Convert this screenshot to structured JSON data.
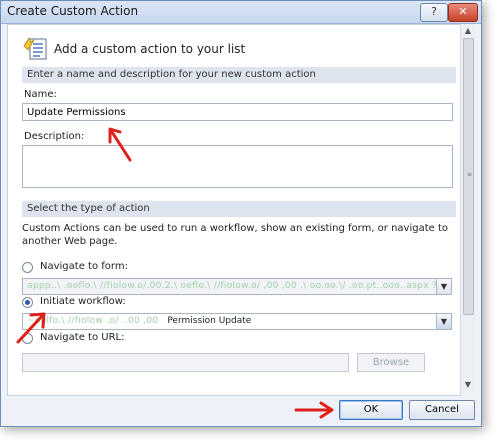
{
  "window": {
    "title": "Create Custom Action",
    "help_label": "?",
    "close_label": "✕"
  },
  "header": {
    "text": "Add a custom action to your list"
  },
  "section_name": {
    "title": "Enter a name and description for your new custom action",
    "name_label": "Name:",
    "name_value": "Update Permissions",
    "description_label": "Description:",
    "description_value": ""
  },
  "section_action": {
    "title": "Select the type of action",
    "description": "Custom Actions can be used to run a workflow, show an existing form, or navigate to another Web page.",
    "options": [
      {
        "label": "Navigate to form:",
        "selected": false
      },
      {
        "label": "Initiate workflow:",
        "selected": true
      },
      {
        "label": "Navigate to URL:",
        "selected": false
      }
    ],
    "form_select_value": "appp..\\ .ooflo.\\ //fiolow.o/.00.2.\\ oeflo.\\ //fiolow.o/ ,00 ,00 .\\ oo.oo.\\/ .oo.pt..ooo..aspx ?ID= • [Sorted]",
    "workflow_prefix": "~oelfo.\\ //fiolow .o/ ..00 ,00",
    "workflow_select_value": "Permission Update",
    "url_value": "",
    "browse_label": "Browse"
  },
  "footer": {
    "ok_label": "OK",
    "cancel_label": "Cancel"
  },
  "colors": {
    "accent_arrow": "#e0201a",
    "title_bar": "#c6d7ee",
    "section_header": "#dde4ee",
    "close_button": "#c7432b"
  }
}
